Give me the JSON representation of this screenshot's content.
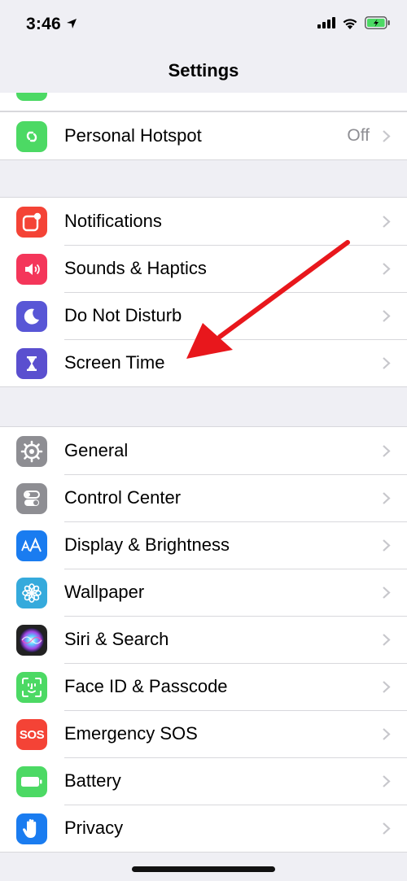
{
  "status_bar": {
    "time": "3:46"
  },
  "nav": {
    "title": "Settings"
  },
  "groups": [
    {
      "items": [
        {
          "label": "Personal Hotspot",
          "value": "Off",
          "icon": "hotspot-icon",
          "color": "#4cd964"
        }
      ]
    },
    {
      "items": [
        {
          "label": "Notifications",
          "icon": "notifications-icon",
          "color": "#f44336"
        },
        {
          "label": "Sounds & Haptics",
          "icon": "speaker-icon",
          "color": "#f4365a"
        },
        {
          "label": "Do Not Disturb",
          "icon": "moon-icon",
          "color": "#5856d6"
        },
        {
          "label": "Screen Time",
          "icon": "hourglass-icon",
          "color": "#5a4fcf"
        }
      ]
    },
    {
      "items": [
        {
          "label": "General",
          "icon": "gear-icon",
          "color": "#8e8e93"
        },
        {
          "label": "Control Center",
          "icon": "toggles-icon",
          "color": "#8e8e93"
        },
        {
          "label": "Display & Brightness",
          "icon": "text-size-icon",
          "color": "#1a7cf0"
        },
        {
          "label": "Wallpaper",
          "icon": "flower-icon",
          "color": "#35aadc"
        },
        {
          "label": "Siri & Search",
          "icon": "siri-icon",
          "color": "#222222"
        },
        {
          "label": "Face ID & Passcode",
          "icon": "face-id-icon",
          "color": "#4cd964"
        },
        {
          "label": "Emergency SOS",
          "icon": "sos-icon",
          "icon_text": "SOS",
          "color": "#f44336"
        },
        {
          "label": "Battery",
          "icon": "battery-icon",
          "color": "#4cd964"
        },
        {
          "label": "Privacy",
          "icon": "hand-icon",
          "color": "#1a7cf0"
        }
      ]
    }
  ],
  "annotation": {
    "type": "arrow",
    "color": "#e8171c",
    "target": "Screen Time"
  }
}
